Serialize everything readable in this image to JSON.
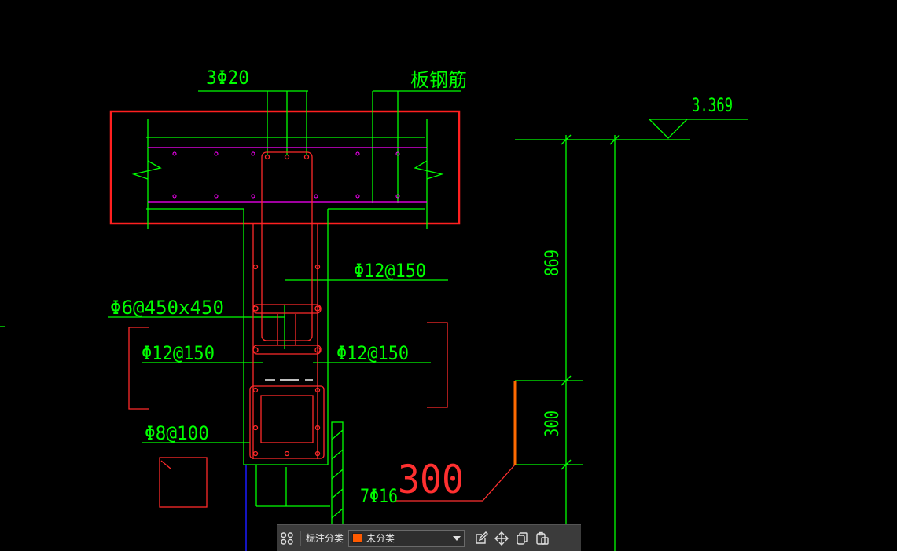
{
  "drawing": {
    "colors": {
      "background": "#000000",
      "dimension": "#00ff00",
      "rebar": "#ff2a2a",
      "highlight_box": "#ff2020",
      "slab_bar": "#ff00ff",
      "dim_accent": "#ff6a00",
      "large_text": "#ff3030",
      "blue_line": "#1a1aff"
    },
    "labels": {
      "top_bars": "3Φ20",
      "slab_rebar": "板钢筋",
      "elevation": "3.369",
      "tie_bars": "Φ6@450x450",
      "stirrup_right_upper": "Φ12@150",
      "stirrup_left": "Φ12@150",
      "stirrup_right": "Φ12@150",
      "hoop": "Φ8@100",
      "bottom_bars": "7Φ16",
      "big_value": "300",
      "dim_869": "869",
      "dim_300": "300"
    }
  },
  "toolbar": {
    "label": "标注分类",
    "category_value": "未分类",
    "category_color": "#ff5a00",
    "icons": [
      "category-grid-icon",
      "edit-icon",
      "move-icon",
      "copy-icon",
      "paste-icon"
    ]
  }
}
